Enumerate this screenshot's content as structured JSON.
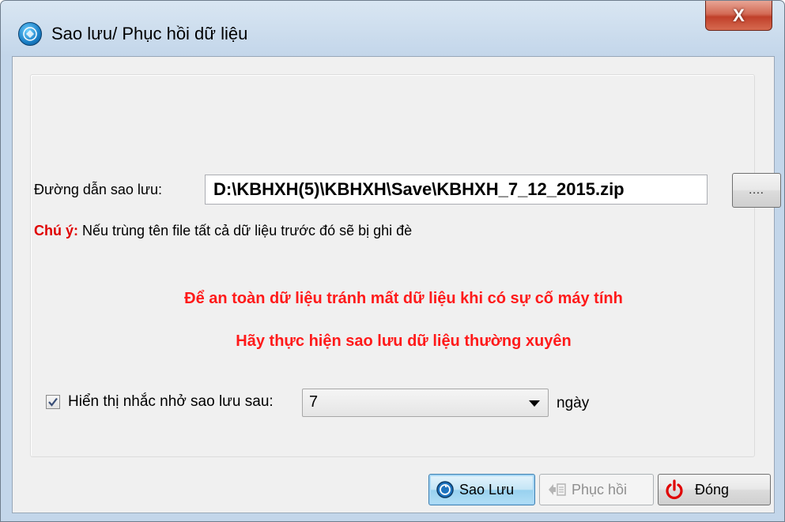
{
  "window": {
    "title": "Sao lưu/ Phục hồi dữ liệu",
    "close_symbol": "X"
  },
  "form": {
    "path_label": "Đường dẫn sao lưu:",
    "path_value": "D:\\KBHXH(5)\\KBHXH\\Save\\KBHXH_7_12_2015.zip",
    "browse_label": "....",
    "note_label": "Chú ý:",
    "note_text": "Nếu trùng tên file tất cả dữ liệu trước đó sẽ bị ghi đè",
    "warning_line1": "Để an toàn dữ liệu tránh mất dữ liệu khi có sự cố máy tính",
    "warning_line2": "Hãy thực hiện sao lưu dữ liệu thường xuyên",
    "reminder_checked": true,
    "reminder_label": "Hiển thị nhắc nhở sao lưu sau:",
    "reminder_value": "7",
    "reminder_unit": "ngày"
  },
  "buttons": {
    "backup": "Sao Lưu",
    "restore": "Phục hồi",
    "close": "Đóng"
  },
  "colors": {
    "warning": "#ff1a1a",
    "note_label": "#e00000",
    "client_bg": "#f0f0f0"
  },
  "icons": {
    "title": "app-globe-icon",
    "backup": "backup-globe-icon",
    "restore": "restore-icon",
    "close": "power-icon"
  }
}
